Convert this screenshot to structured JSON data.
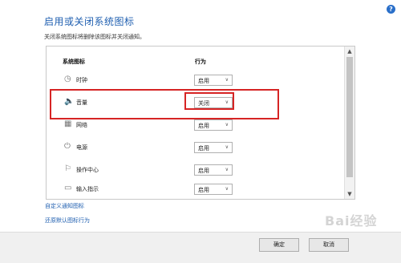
{
  "help_icon": "?",
  "title": "启用或关闭系统图标",
  "subtitle": "关闭系统图标将删除该图标并关闭通知。",
  "columns": {
    "icon_header": "系统图标",
    "behavior_header": "行为"
  },
  "rows": [
    {
      "icon": "clock-icon",
      "glyph": "◷",
      "label": "时钟",
      "value": "启用"
    },
    {
      "icon": "volume-icon",
      "glyph": "🔈",
      "label": "音量",
      "value": "关闭"
    },
    {
      "icon": "network-icon",
      "glyph": "▦",
      "label": "网络",
      "value": "启用"
    },
    {
      "icon": "power-icon",
      "glyph": "⏻",
      "label": "电源",
      "value": "启用"
    },
    {
      "icon": "action-center-icon",
      "glyph": "⚐",
      "label": "操作中心",
      "value": "启用"
    },
    {
      "icon": "input-indicator-icon",
      "glyph": "▭",
      "label": "输入指示",
      "value": "启用"
    }
  ],
  "links": {
    "customize": "自定义通知图标",
    "restore": "还原默认图标行为"
  },
  "buttons": {
    "ok": "确定",
    "cancel": "取消"
  },
  "watermark": "Bai经验",
  "colors": {
    "accent": "#1f5fb0",
    "highlight": "#d62424"
  }
}
